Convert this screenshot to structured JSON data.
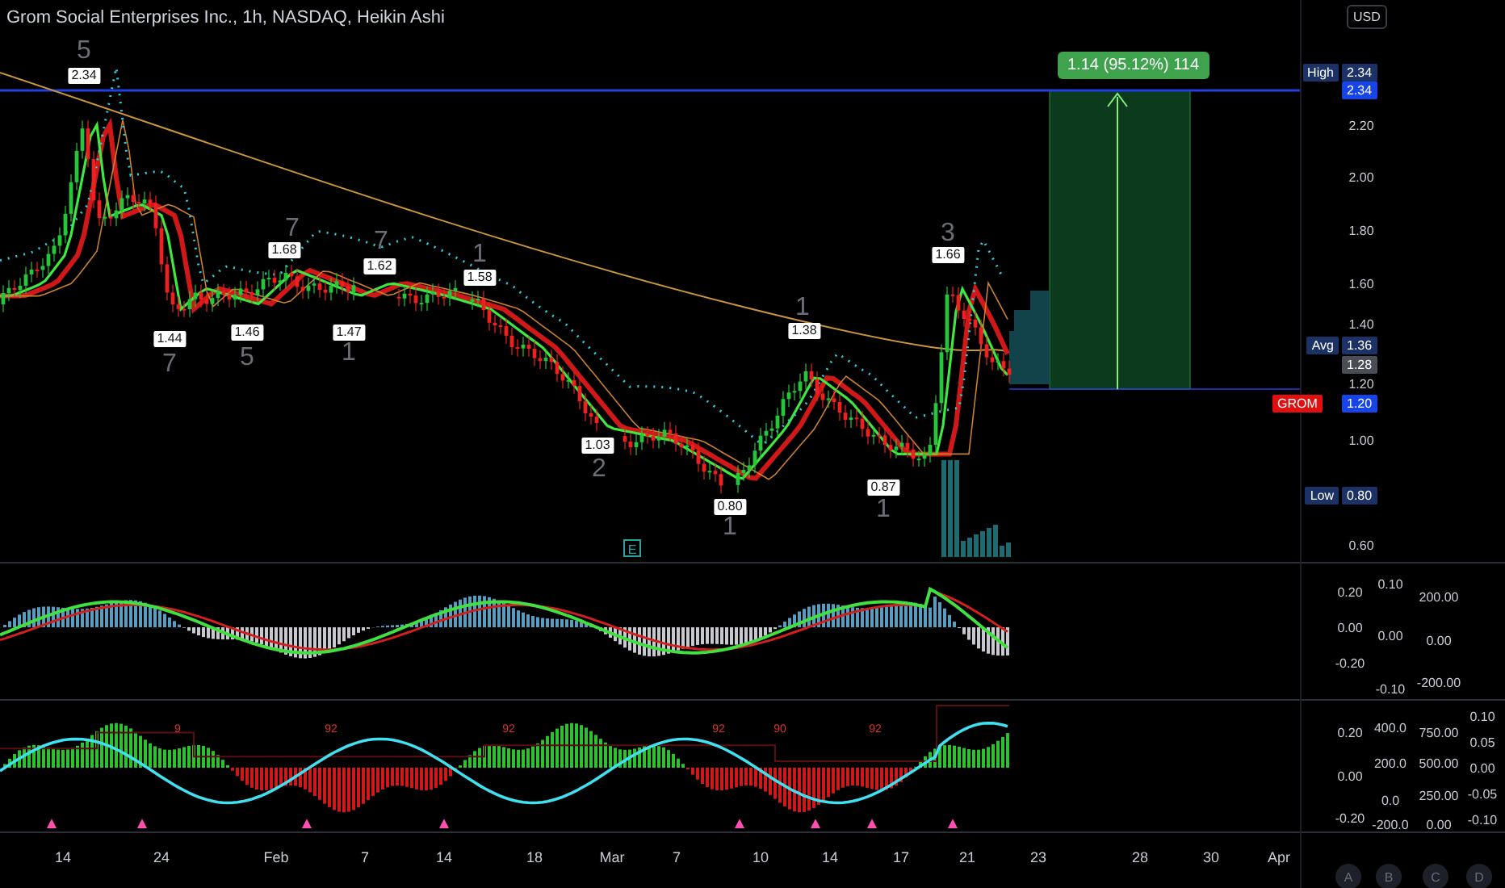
{
  "chart": {
    "title": "Grom Social Enterprises Inc., 1h, NASDAQ, Heikin Ashi",
    "price_labels": [
      "2.34",
      "1.44",
      "1.46",
      "1.68",
      "1.47",
      "1.62",
      "1.58",
      "1.03",
      "0.80",
      "1.38",
      "0.87",
      "1.66"
    ],
    "wave_numbers": [
      "5",
      "7",
      "5",
      "7",
      "1",
      "7",
      "1",
      "2",
      "1",
      "1",
      "1",
      "3"
    ],
    "measure": {
      "label": "1.14 (95.12%) 114"
    },
    "earnings_marker": "E"
  },
  "price_axis": {
    "currency": "USD",
    "ticks": [
      "2.20",
      "2.00",
      "1.80",
      "1.60",
      "1.40",
      "1.20",
      "1.00",
      "0.60"
    ],
    "tags": [
      {
        "kind": "stat",
        "name": "High",
        "value": "2.34",
        "color": "#1c3166"
      },
      {
        "kind": "plain",
        "value": "2.34",
        "color": "#1744e8"
      },
      {
        "kind": "stat",
        "name": "Avg",
        "value": "1.36",
        "color": "#1c3166"
      },
      {
        "kind": "plain",
        "value": "1.28",
        "color": "#4a4d55"
      },
      {
        "kind": "symbol",
        "name": "GROM",
        "value": "1.20",
        "color": "#1744e8"
      },
      {
        "kind": "stat",
        "name": "Low",
        "value": "0.80",
        "color": "#1c3166"
      }
    ]
  },
  "oscillator_pane": {
    "scales": [
      [
        "0.20",
        "0.00",
        "-0.20"
      ],
      [
        "0.10",
        "0.00",
        "-0.10"
      ],
      [
        "200.00",
        "0.00",
        "-200.00"
      ]
    ]
  },
  "momentum_pane": {
    "signals": [
      "9",
      "92",
      "92",
      "92",
      "90",
      "92"
    ],
    "scales": [
      [
        "0.20",
        "0.00",
        "-0.20"
      ],
      [
        "400.0",
        "200.0",
        "0.0",
        "-200.0"
      ],
      [
        "750.00",
        "500.00",
        "250.00",
        "0.00"
      ],
      [
        "0.10",
        "0.05",
        "0.00",
        "-0.05",
        "-0.10"
      ]
    ]
  },
  "time_axis": [
    "14",
    "24",
    "Feb",
    "7",
    "14",
    "18",
    "Mar",
    "7",
    "10",
    "14",
    "17",
    "21",
    "23",
    "28",
    "30",
    "Apr"
  ],
  "scale_buttons": [
    "A",
    "B",
    "C",
    "D"
  ]
}
